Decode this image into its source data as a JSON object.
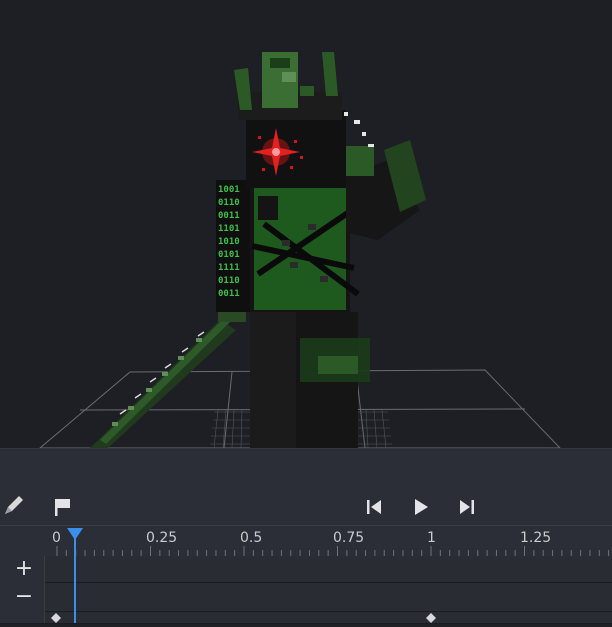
{
  "viewport": {
    "background": "#1e1f24"
  },
  "toolbar": {
    "pencil_icon": "pencil-icon",
    "flag_icon": "flag-icon",
    "skip_back_icon": "skip-to-start-icon",
    "play_icon": "play-icon",
    "skip_forward_icon": "skip-to-end-icon"
  },
  "timeline": {
    "ticks": [
      "0",
      "0.25",
      "0.5",
      "0.75",
      "1",
      "1.25"
    ],
    "playhead_color": "#3b8eea",
    "add_label": "+",
    "remove_label": "−"
  }
}
